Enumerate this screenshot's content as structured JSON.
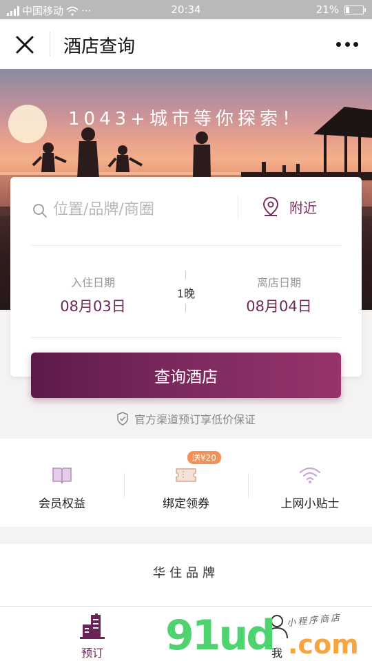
{
  "status_bar": {
    "carrier": "中国移动",
    "extra": "···",
    "time": "20:34",
    "battery_percent": "21%",
    "battery_level": 0.21
  },
  "nav": {
    "title": "酒店查询"
  },
  "banner": {
    "headline": "1043+城市等你探索！"
  },
  "search": {
    "placeholder": "位置/品牌/商圈",
    "nearby_label": "附近"
  },
  "dates": {
    "checkin_label": "入住日期",
    "checkin_value": "08月03日",
    "checkout_label": "离店日期",
    "checkout_value": "08月04日",
    "nights": "1晚"
  },
  "query_button": "查询酒店",
  "guarantee": "官方渠道预订享低价保证",
  "actions": [
    {
      "label": "会员权益",
      "icon": "book-icon"
    },
    {
      "label": "绑定领券",
      "icon": "ticket-icon",
      "badge": "送¥20"
    },
    {
      "label": "上网小贴士",
      "icon": "wifi-icon"
    }
  ],
  "brand": {
    "title": "华住品牌"
  },
  "tabs": [
    {
      "label": "预订",
      "icon": "hotel-building-icon",
      "active": true
    },
    {
      "label": "我",
      "icon": "user-icon",
      "active": false
    }
  ],
  "watermark": {
    "main": "91ud",
    "suffix": ".com",
    "sub": "小程序商店"
  },
  "colors": {
    "accent": "#6a2457",
    "button_start": "#5c1a49",
    "button_end": "#96346c",
    "badge": "#f19057"
  }
}
